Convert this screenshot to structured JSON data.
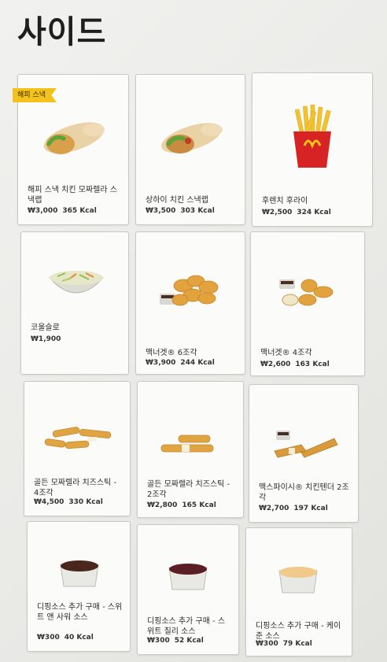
{
  "page": {
    "title": "사이드"
  },
  "badge": {
    "label": "해피 스낵"
  },
  "items": [
    {
      "name": "해피 스낵 치킨 모짜렐라 스낵랩",
      "price": "₩3,000",
      "kcal": "365 Kcal",
      "icon": "wrap-icon"
    },
    {
      "name": "상하이 치킨 스낵랩",
      "price": "₩3,500",
      "kcal": "303 Kcal",
      "icon": "wrap-icon"
    },
    {
      "name": "후렌치 후라이",
      "price": "₩2,500",
      "kcal": "324 Kcal",
      "icon": "fries-icon"
    },
    {
      "name": "코울슬로",
      "price": "₩1,900",
      "kcal": "",
      "icon": "coleslaw-icon"
    },
    {
      "name": "맥너겟® 6조각",
      "price": "₩3,900",
      "kcal": "244 Kcal",
      "icon": "nuggets-icon"
    },
    {
      "name": "맥너겟® 4조각",
      "price": "₩2,600",
      "kcal": "163 Kcal",
      "icon": "nuggets-icon"
    },
    {
      "name": "골든 모짜렐라 치즈스틱 - 4조각",
      "price": "₩4,500",
      "kcal": "330 Kcal",
      "icon": "cheese-stick-icon"
    },
    {
      "name": "골든 모짜렐라 치즈스틱 - 2조각",
      "price": "₩2,800",
      "kcal": "165 Kcal",
      "icon": "cheese-stick-icon"
    },
    {
      "name": "맥스파이시® 치킨텐더 2조각",
      "price": "₩2,700",
      "kcal": "197 Kcal",
      "icon": "chicken-tender-icon"
    },
    {
      "name": "디핑소스 추가 구매 - 스위트 앤 사워 소스",
      "price": "₩300",
      "kcal": "40 Kcal",
      "icon": "sauce-cup-icon"
    },
    {
      "name": "디핑소스 추가 구매 - 스위트 칠리 소스",
      "price": "₩300",
      "kcal": "52 Kcal",
      "icon": "sauce-cup-icon"
    },
    {
      "name": "디핑소스 추가 구매 - 케이준 소스",
      "price": "₩300",
      "kcal": "79 Kcal",
      "icon": "sauce-cup-icon"
    }
  ]
}
